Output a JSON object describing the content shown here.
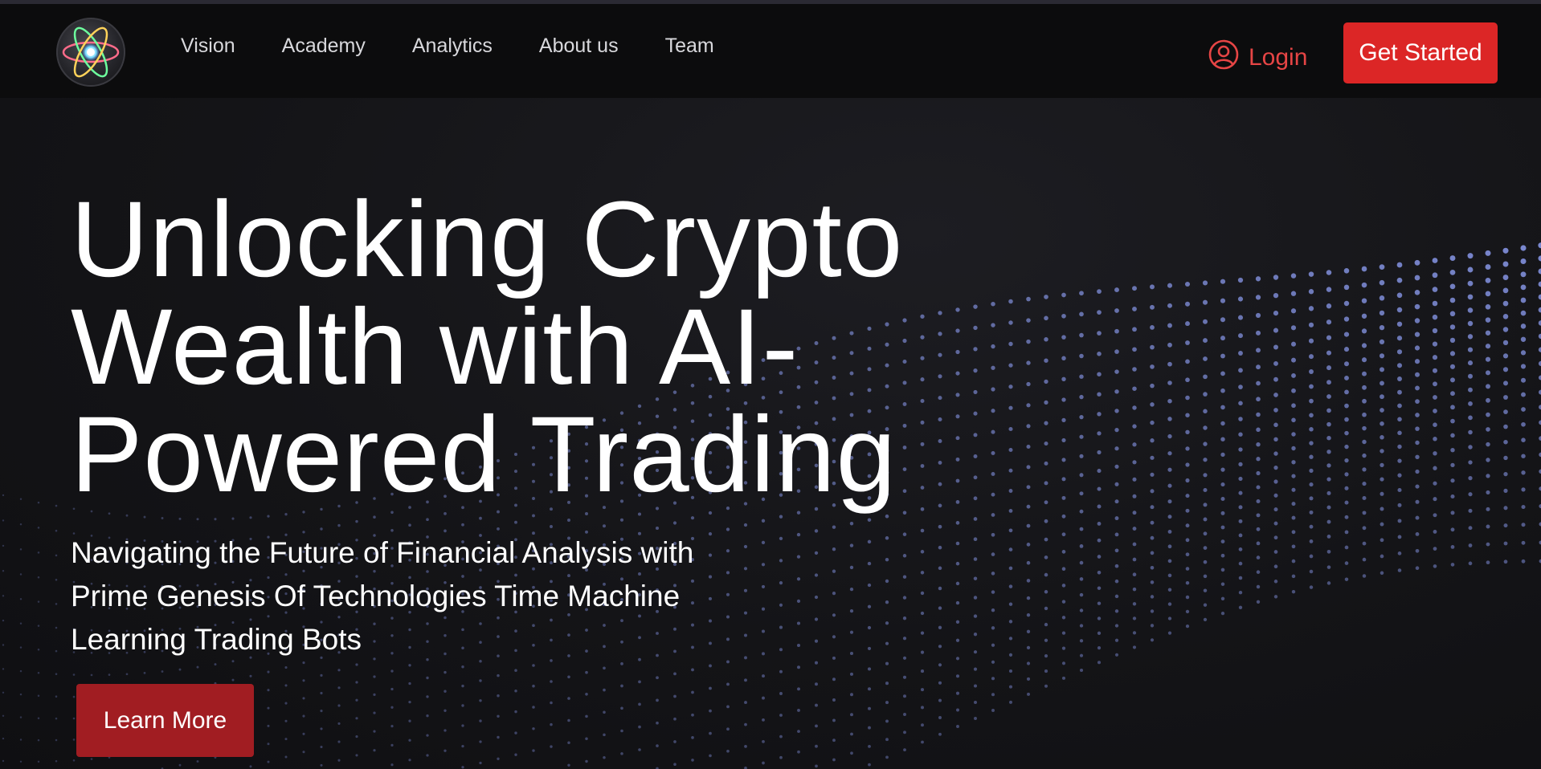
{
  "nav": {
    "logo_icon": "atom-icon",
    "links": [
      "Vision",
      "Academy",
      "Analytics",
      "About us",
      "Team"
    ],
    "login_label": "Login",
    "login_icon": "user-circle-icon",
    "cta_label": "Get Started"
  },
  "hero": {
    "title": "Unlocking Crypto Wealth with AI-Powered Trading",
    "subtitle": "Navigating the Future of Financial Analysis with Prime Genesis Of Technologies Time Machine Learning Trading Bots",
    "button_label": "Learn More",
    "background": "particle-wave"
  },
  "colors": {
    "accent": "#dc2626",
    "login": "#e64545",
    "learn_more": "#a11d22",
    "particles": "#8c9cf0",
    "background": "#121215"
  }
}
